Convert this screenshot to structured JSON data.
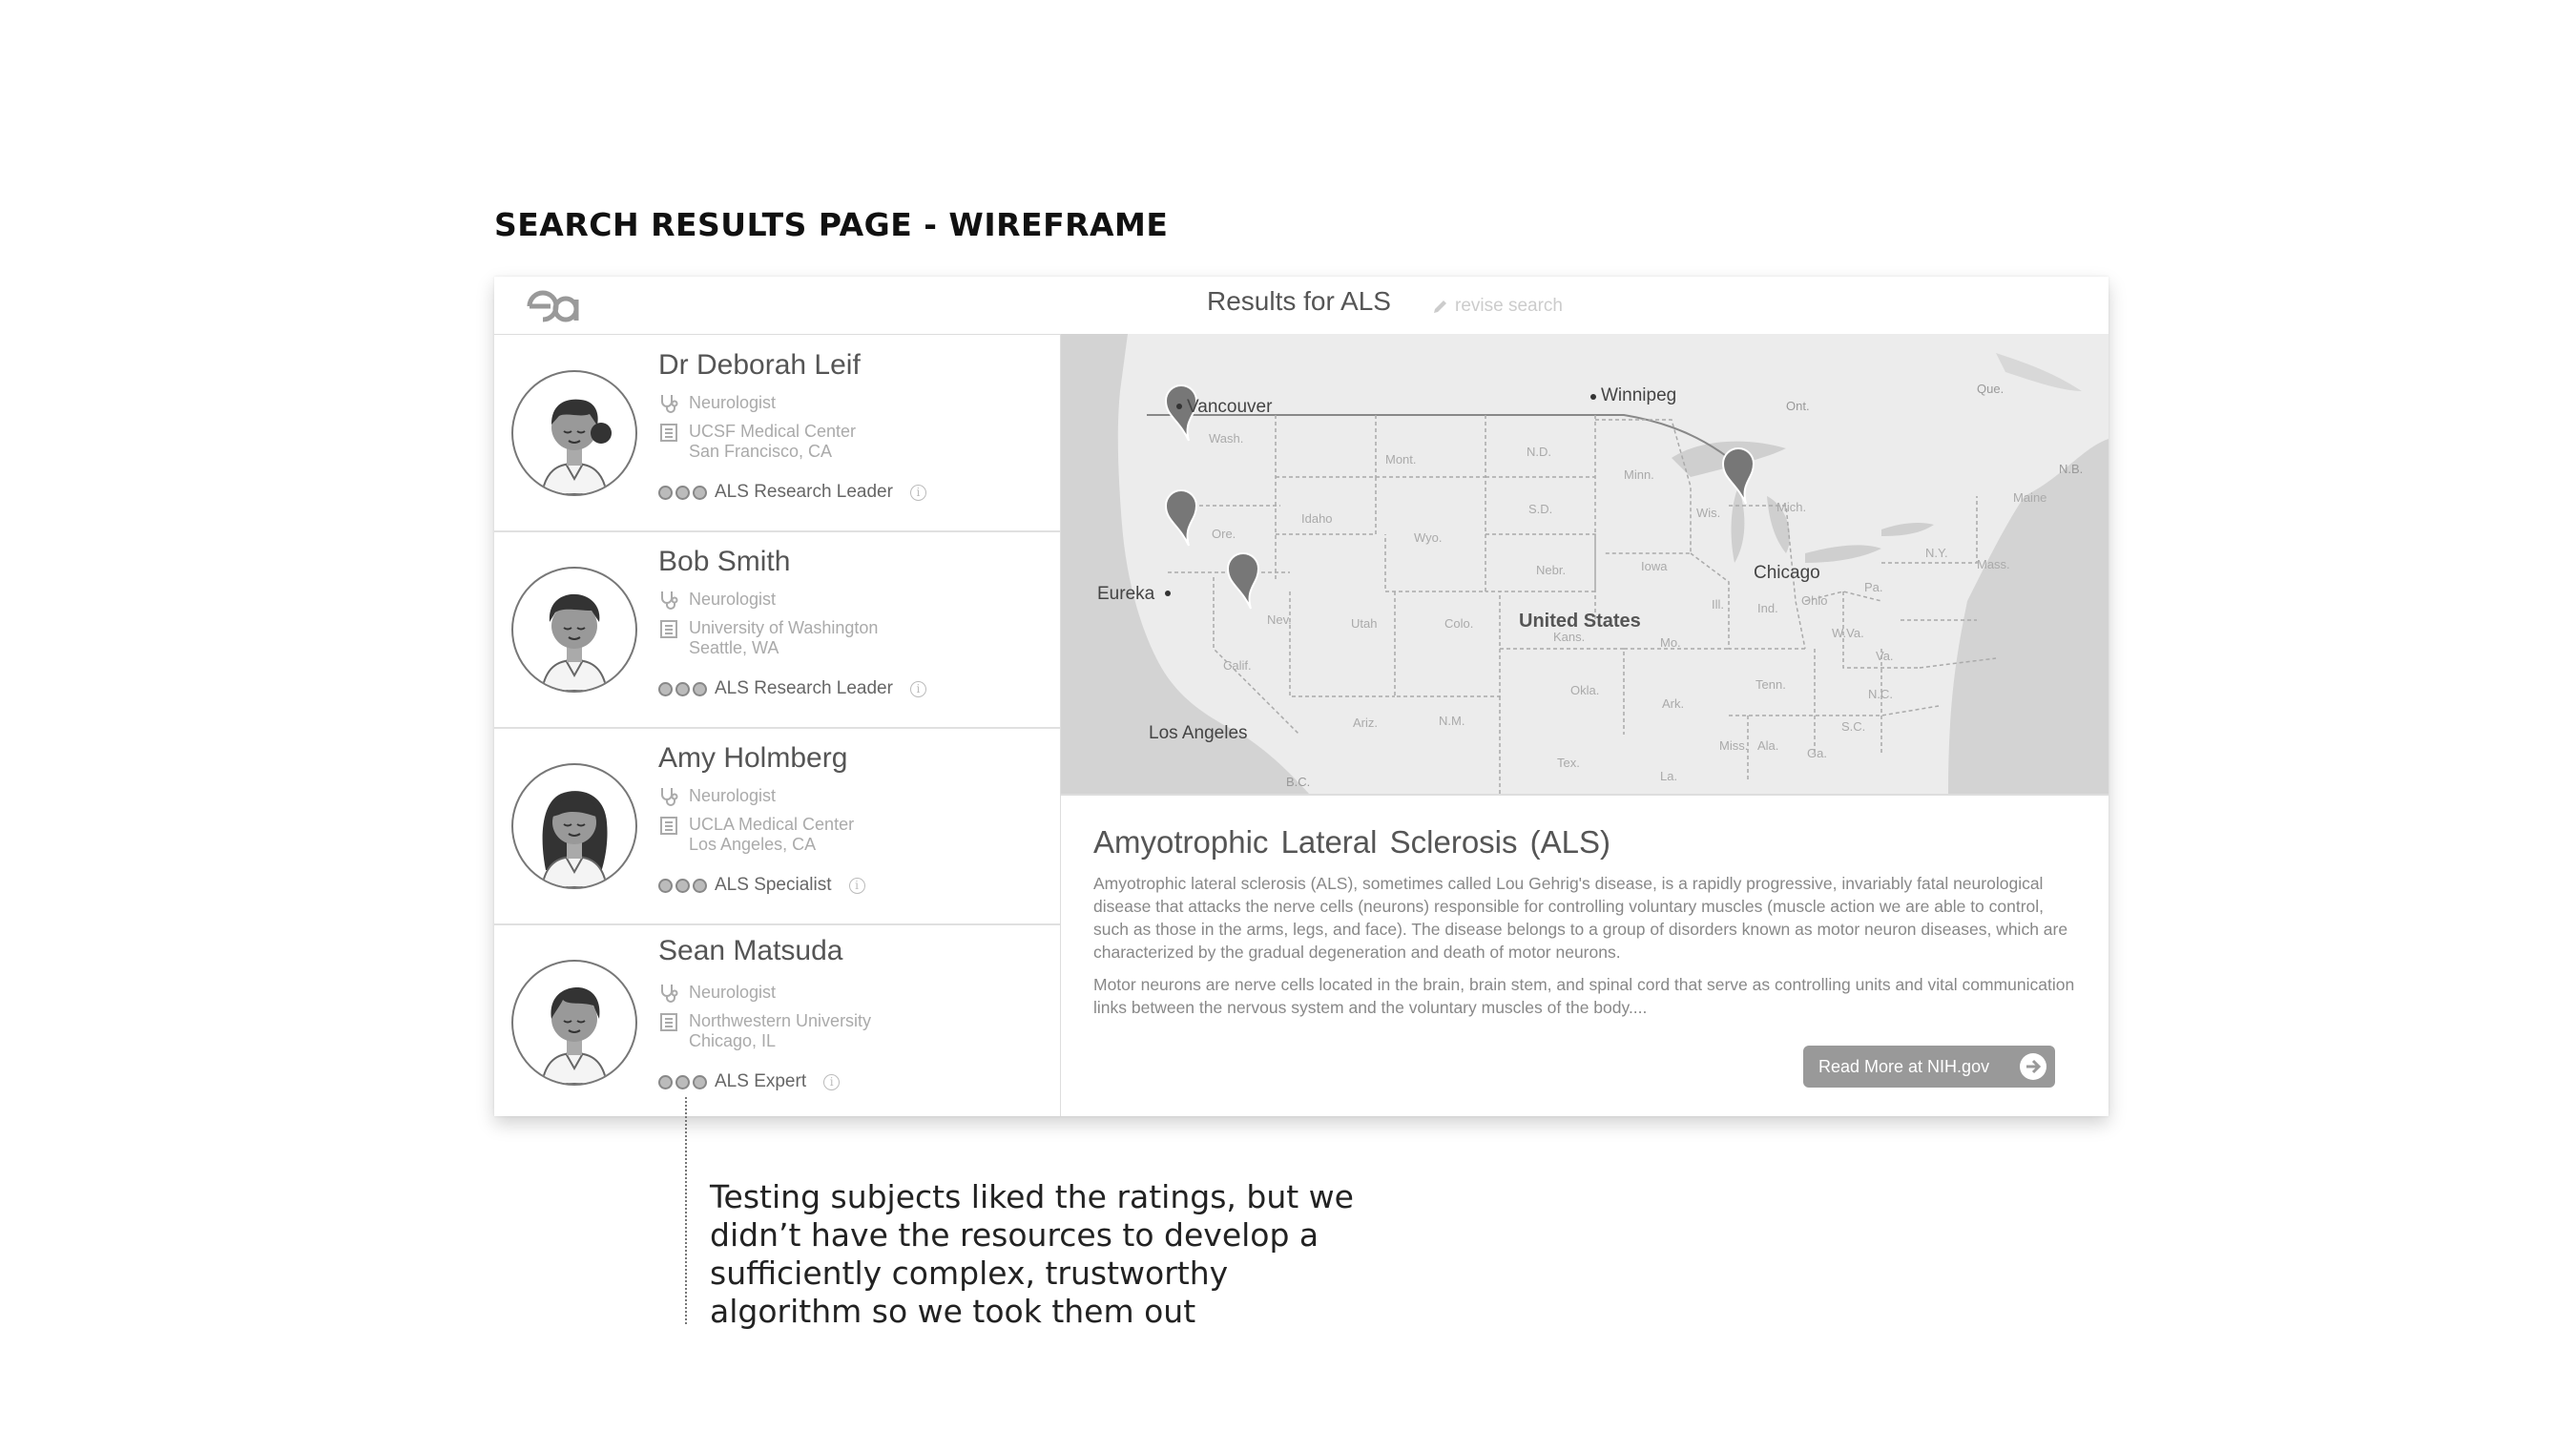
{
  "page_title": "SEARCH RESULTS PAGE - WIREFRAME",
  "topbar": {
    "logo_icon": "ea-logo",
    "results_title": "Results for ALS",
    "revise_label": "revise search",
    "revise_icon": "pencil-icon"
  },
  "doctors": [
    {
      "name": "Dr Deborah Leif",
      "specialty": "Neurologist",
      "institution": "UCSF Medical Center",
      "location": "San Francisco, CA",
      "rating_label": "ALS Research Leader",
      "rating_dots": 3
    },
    {
      "name": "Bob Smith",
      "specialty": "Neurologist",
      "institution": "University of Washington",
      "location": "Seattle, WA",
      "rating_label": "ALS Research Leader",
      "rating_dots": 3
    },
    {
      "name": "Amy Holmberg",
      "specialty": "Neurologist",
      "institution": "UCLA Medical Center",
      "location": "Los Angeles, CA",
      "rating_label": "ALS Specialist",
      "rating_dots": 3
    },
    {
      "name": "Sean Matsuda",
      "specialty": "Neurologist",
      "institution": "Northwestern University",
      "location": "Chicago, IL",
      "rating_label": "ALS Expert",
      "rating_dots": 3
    }
  ],
  "map": {
    "cities": {
      "vancouver": "Vancouver",
      "winnipeg": "Winnipeg",
      "eureka": "Eureka",
      "chicago": "Chicago",
      "los_angeles": "Los Angeles"
    },
    "country": "United States",
    "states": {
      "wash": "Wash.",
      "ore": "Ore.",
      "calif": "Calif.",
      "idaho": "Idaho",
      "mont": "Mont.",
      "nev": "Nev.",
      "utah": "Utah",
      "ariz": "Ariz.",
      "wyo": "Wyo.",
      "colo": "Colo.",
      "nm": "N.M.",
      "nd": "N.D.",
      "sd": "S.D.",
      "nebr": "Nebr.",
      "kans": "Kans.",
      "okla": "Okla.",
      "tex": "Tex.",
      "minn": "Minn.",
      "iowa": "Iowa",
      "mo": "Mo.",
      "ark": "Ark.",
      "la": "La.",
      "wis": "Wis.",
      "ill": "Ill.",
      "mich": "Mich.",
      "ind": "Ind.",
      "ohio": "Ohio",
      "tenn": "Tenn.",
      "miss": "Miss.",
      "ala": "Ala.",
      "ga": "Ga.",
      "sc": "S.C.",
      "nc": "N.C.",
      "va": "Va.",
      "wva": "W.Va.",
      "pa": "Pa.",
      "ny": "N.Y.",
      "mass": "Mass.",
      "maine": "Maine",
      "ont": "Ont.",
      "que": "Que.",
      "nb": "N.B.",
      "bc": "B.C."
    },
    "pin_icon": "map-pin-icon"
  },
  "description": {
    "title": "Amyotrophic  Lateral  Sclerosis (ALS)",
    "paragraph1": "Amyotrophic lateral sclerosis (ALS), sometimes called Lou Gehrig's disease, is a rapidly progressive, invariably fatal neurological disease that attacks the nerve cells (neurons) responsible for controlling voluntary muscles (muscle action we are able to control, such as those in the arms, legs, and face). The disease belongs to a group of disorders known as motor neuron diseases, which are characterized by the gradual degeneration and death of motor neurons.",
    "paragraph2": "Motor neurons are nerve cells located in the brain, brain stem, and spinal cord that serve as controlling units and vital communication links between the nervous system and the voluntary muscles of the body....",
    "read_more": "Read More at NIH.gov",
    "read_more_icon": "arrow-right-circle-icon"
  },
  "annotation": "Testing subjects liked the ratings, but we didn’t have the resources to develop a sufficiently complex, trustworthy algorithm so we took them out"
}
